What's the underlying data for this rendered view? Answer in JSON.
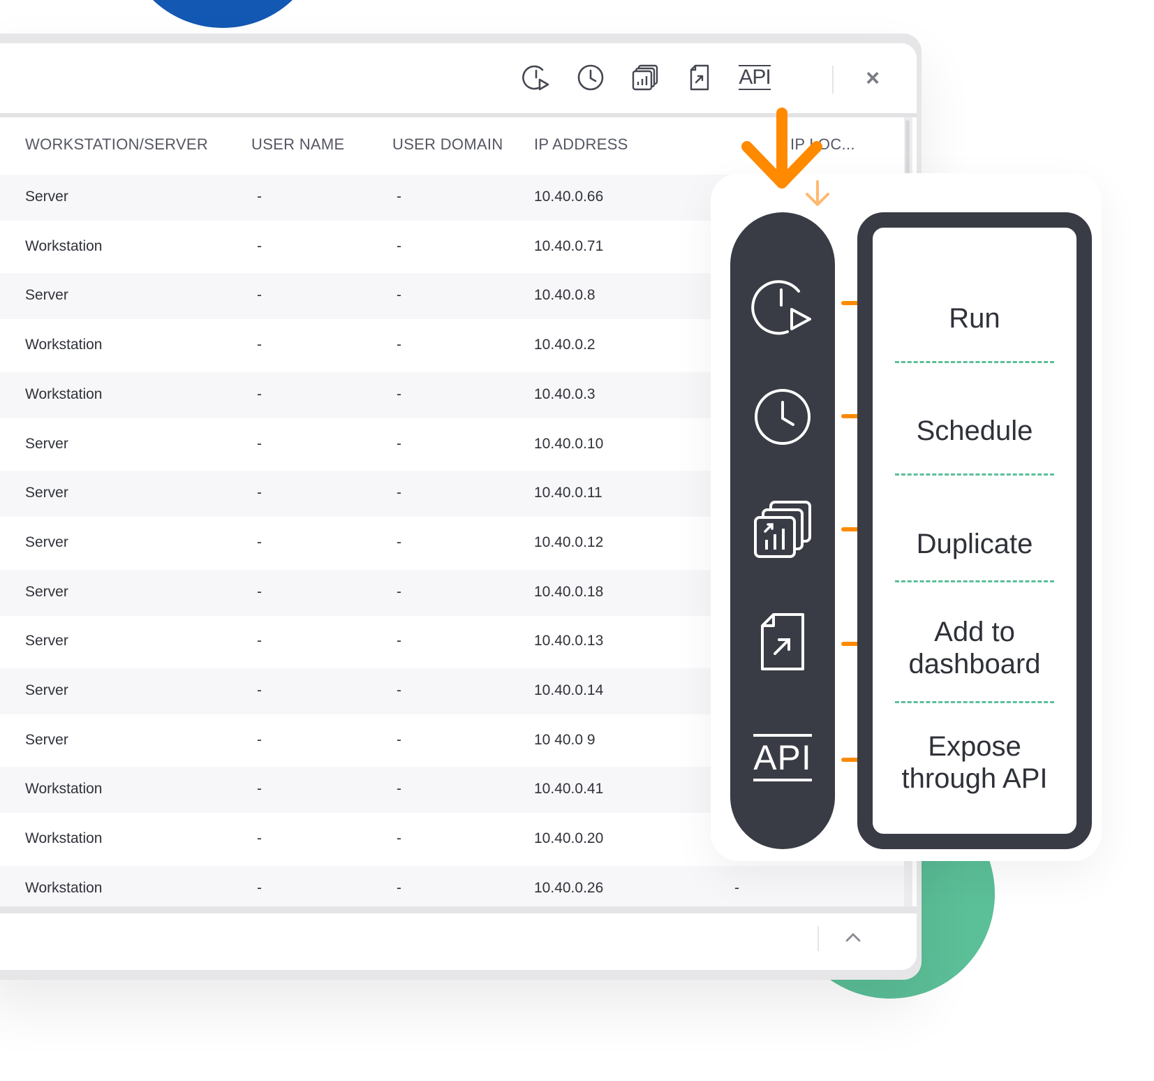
{
  "toolbar": {
    "icons": [
      "run-icon",
      "schedule-icon",
      "duplicate-icon",
      "add-to-dashboard-icon",
      "api-icon",
      "close-icon"
    ],
    "api_label": "API",
    "close_label": "×"
  },
  "table": {
    "columns": [
      "WORKSTATION/SERVER",
      "USER NAME",
      "USER DOMAIN",
      "IP ADDRESS",
      "IP LOC..."
    ],
    "rows": [
      {
        "type": "Server",
        "user": "-",
        "domain": "-",
        "ip": "10.40.0.66"
      },
      {
        "type": "Workstation",
        "user": "-",
        "domain": "-",
        "ip": "10.40.0.71"
      },
      {
        "type": "Server",
        "user": "-",
        "domain": "-",
        "ip": "10.40.0.8"
      },
      {
        "type": "Workstation",
        "user": "-",
        "domain": "-",
        "ip": "10.40.0.2"
      },
      {
        "type": "Workstation",
        "user": "-",
        "domain": "-",
        "ip": "10.40.0.3"
      },
      {
        "type": "Server",
        "user": "-",
        "domain": "-",
        "ip": "10.40.0.10"
      },
      {
        "type": "Server",
        "user": "-",
        "domain": "-",
        "ip": "10.40.0.11"
      },
      {
        "type": "Server",
        "user": "-",
        "domain": "-",
        "ip": "10.40.0.12"
      },
      {
        "type": "Server",
        "user": "-",
        "domain": "-",
        "ip": "10.40.0.18"
      },
      {
        "type": "Server",
        "user": "-",
        "domain": "-",
        "ip": "10.40.0.13"
      },
      {
        "type": "Server",
        "user": "-",
        "domain": "-",
        "ip": "10.40.0.14"
      },
      {
        "type": "Server",
        "user": "-",
        "domain": "-",
        "ip": "10 40.0 9"
      },
      {
        "type": "Workstation",
        "user": "-",
        "domain": "-",
        "ip": "10.40.0.41"
      },
      {
        "type": "Workstation",
        "user": "-",
        "domain": "-",
        "ip": "10.40.0.20"
      },
      {
        "type": "Workstation",
        "user": "-",
        "domain": "-",
        "ip": "10.40.0.26",
        "location": "-"
      }
    ]
  },
  "callout": {
    "pill_icons": [
      "run-icon",
      "schedule-icon",
      "duplicate-icon",
      "add-to-dashboard-icon",
      "api-icon"
    ],
    "pill_api_label": "API",
    "items": [
      "Run",
      "Schedule",
      "Duplicate",
      "Add to dashboard",
      "Expose through API"
    ]
  },
  "colors": {
    "accent_orange": "#ff8a00",
    "dash_green": "#5bbf98",
    "pill_dark": "#3a3c45",
    "circle_blue": "#1358b3",
    "circle_green": "#5bbf98"
  }
}
